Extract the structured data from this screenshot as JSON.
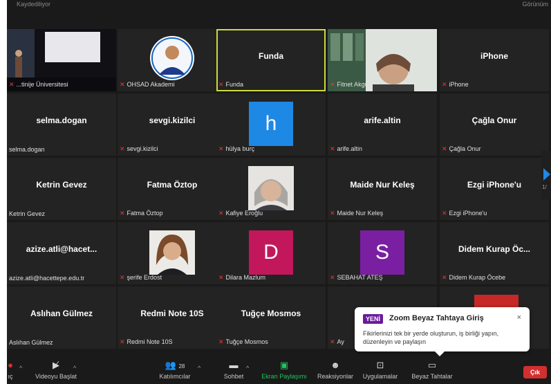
{
  "topbar": {
    "left_text": "Kaydediliyor",
    "right_text": "Görünüm"
  },
  "tiles": [
    {
      "label": "...tinije Üniversitesi",
      "type": "photo",
      "photo": "stage"
    },
    {
      "label": "OHSAD Akademi",
      "type": "photo",
      "photo": "logo"
    },
    {
      "name": "Funda",
      "label": "Funda",
      "speaking": true
    },
    {
      "label": "Fitnet Akgül",
      "type": "photo",
      "photo": "woman-office"
    },
    {
      "name": "iPhone",
      "label": "iPhone"
    },
    {
      "name": "selma.dogan",
      "label": "selma.dogan",
      "nomic": true
    },
    {
      "name": "sevgi.kizilci",
      "label": "sevgi.kizilci"
    },
    {
      "label": "hülya burç",
      "type": "avatar",
      "letter": "h",
      "color": "#1e88e5"
    },
    {
      "name": "arife.altin",
      "label": "arife.altin"
    },
    {
      "name": "Çağla Onur",
      "label": "Çağla Onur"
    },
    {
      "name": "Ketrin Gevez",
      "label": "Ketrin Gevez",
      "nomic": true
    },
    {
      "name": "Fatma Öztop",
      "label": "Fatma Öztop"
    },
    {
      "label": "Kafiye Eroğlu",
      "type": "photo",
      "photo": "grey-hair"
    },
    {
      "name": "Maide Nur Keleş",
      "label": "Maide Nur Keleş"
    },
    {
      "name": "Ezgi iPhone'u",
      "label": "Ezgi iPhone'u"
    },
    {
      "name": "azize.atli@hacet...",
      "label": "azize.atli@hacettepe.edu.tr",
      "nomic": true
    },
    {
      "label": "şerife Erdost",
      "type": "photo",
      "photo": "curly-hair"
    },
    {
      "label": "Dilara Mazlum",
      "type": "avatar",
      "letter": "D",
      "color": "#c2185b"
    },
    {
      "label": "SEBAHAT ATEŞ",
      "type": "avatar",
      "letter": "S",
      "color": "#7b1fa2"
    },
    {
      "name": "Didem  Kurap Öc...",
      "label": "Didem Kurap Öcebe"
    },
    {
      "name": "Aslıhan Gülmez",
      "label": "Aslıhan Gülmez",
      "nomic": true
    },
    {
      "name": "Redmi Note 10S",
      "label": "Redmi Note 10S"
    },
    {
      "name": "Tuğçe Mosmos",
      "label": "Tuğçe Mosmos"
    },
    {
      "label": "Ay",
      "type": "blank"
    },
    {
      "label": "",
      "type": "redblock"
    }
  ],
  "nav": {
    "page": "1/"
  },
  "toolbar": {
    "video": "Videoyu Başlat",
    "participants": "Katılımcılar",
    "participants_count": "28",
    "chat": "Sohbet",
    "share": "Ekran Paylaşımı",
    "reactions": "Reaksiyonlar",
    "apps": "Uygulamalar",
    "whiteboards": "Beyaz Tahtalar",
    "mute_partial": "ıç",
    "end": "Çık"
  },
  "tooltip": {
    "badge": "YENİ",
    "title": "Zoom Beyaz Tahtaya Giriş",
    "close": "×",
    "body": "Fikirlerinizi tek bir yerde oluşturun, iş birliği yapın, düzenleyin ve paylaşın"
  },
  "colors": {
    "speaking_border": "#cddc39",
    "share_green": "#22c55e",
    "end_red": "#d32f2f",
    "new_badge": "#6a1b9a"
  }
}
